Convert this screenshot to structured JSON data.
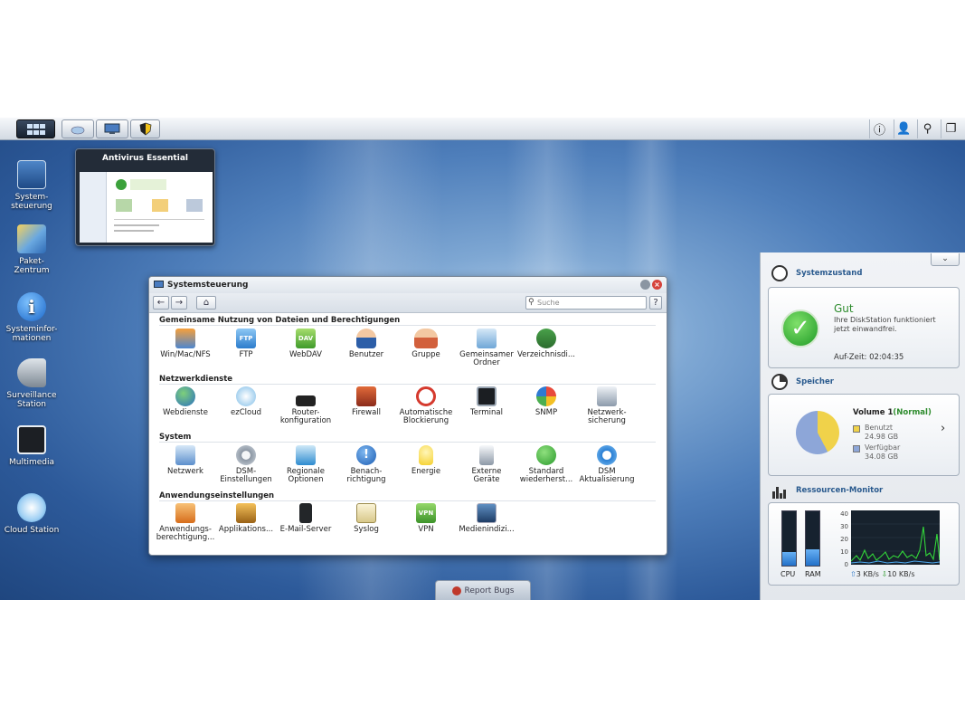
{
  "taskbar": {
    "icons": [
      "grid-icon",
      "cloud-icon",
      "monitor-icon",
      "shield-icon"
    ],
    "right_icons": [
      "info-icon",
      "user-icon",
      "search-icon",
      "windows-icon"
    ]
  },
  "desktop_icons": [
    {
      "label": "System-\nsteuerung"
    },
    {
      "label": "Paket-\nZentrum"
    },
    {
      "label": "Systeminfor-\nmationen"
    },
    {
      "label": "Surveillance\nStation"
    },
    {
      "label": "Multimedia"
    },
    {
      "label": "Cloud Station"
    }
  ],
  "preview": {
    "title": "Antivirus Essential"
  },
  "window": {
    "title": "Systemsteuerung",
    "search_placeholder": "Suche",
    "help": "?",
    "sections": [
      {
        "title": "Gemeinsame Nutzung von Dateien und Berechtigungen",
        "items": [
          "Win/Mac/NFS",
          "FTP",
          "WebDAV",
          "Benutzer",
          "Gruppe",
          "Gemeinsamer\nOrdner",
          "Verzeichnisdi..."
        ]
      },
      {
        "title": "Netzwerkdienste",
        "items": [
          "Webdienste",
          "ezCloud",
          "Router-\nkonfiguration",
          "Firewall",
          "Automatische\nBlockierung",
          "Terminal",
          "SNMP",
          "Netzwerk-\nsicherung"
        ]
      },
      {
        "title": "System",
        "items": [
          "Netzwerk",
          "DSM-\nEinstellungen",
          "Regionale\nOptionen",
          "Benach-\nrichtigung",
          "Energie",
          "Externe\nGeräte",
          "Standard\nwiederherst...",
          "DSM\nAktualisierung"
        ]
      },
      {
        "title": "Anwendungseinstellungen",
        "items": [
          "Anwendungs-\nberechtigung...",
          "Applikations...",
          "E-Mail-Server",
          "Syslog",
          "VPN",
          "Medienindizi..."
        ]
      }
    ]
  },
  "widgets": {
    "health": {
      "title": "Systemzustand",
      "status": "Gut",
      "message": "Ihre DiskStation funktioniert jetzt einwandfrei.",
      "uptime": "Auf-Zeit: 02:04:35"
    },
    "storage": {
      "title": "Speicher",
      "volume": "Volume 1",
      "volume_status": "(Normal)",
      "used_label": "Benutzt",
      "used_value": "24.98 GB",
      "free_label": "Verfügbar",
      "free_value": "34.08 GB",
      "used_color": "#f0d24a",
      "free_color": "#8da6d8"
    },
    "resource": {
      "title": "Ressourcen-Monitor",
      "cpu_label": "CPU",
      "ram_label": "RAM",
      "y_ticks": [
        "40",
        "30",
        "20",
        "10",
        "0"
      ],
      "upload": "3 KB/s",
      "download": "10 KB/s",
      "cpu_level": 0.25,
      "ram_level": 0.3
    }
  },
  "report_bugs": "Report Bugs"
}
